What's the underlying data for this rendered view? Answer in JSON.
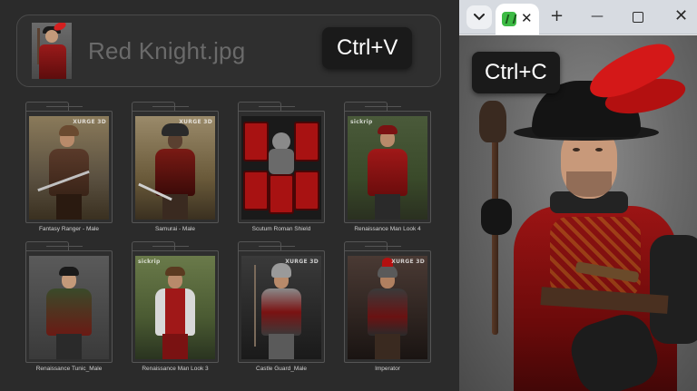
{
  "drop_zone": {
    "filename": "Red Knight.jpg",
    "paste_hint": "Ctrl+V"
  },
  "assets": [
    {
      "label": "Fantasy Ranger - Male",
      "brand": "XURGE 3D"
    },
    {
      "label": "Samurai - Male",
      "brand": "XURGE 3D"
    },
    {
      "label": "Scutum Roman Shield",
      "brand": ""
    },
    {
      "label": "Renaissance Man Look 4",
      "brand": "sickrip"
    },
    {
      "label": "Renaissance Tunic_Male",
      "brand": ""
    },
    {
      "label": "Renaissance Man Look 3",
      "brand": "sickrip"
    },
    {
      "label": "Castle Guard_Male",
      "brand": "XURGE 3D"
    },
    {
      "label": "Imperator",
      "brand": "XURGE 3D"
    }
  ],
  "browser": {
    "tab_close": "✕",
    "new_tab": "+",
    "minimize": "—",
    "close": "✕",
    "copy_hint": "Ctrl+C"
  },
  "colors": {
    "background": "#2b2b2b",
    "hint_bg": "#1a1a1a",
    "favicon": "#3dbb45",
    "plume": "#d41818"
  }
}
